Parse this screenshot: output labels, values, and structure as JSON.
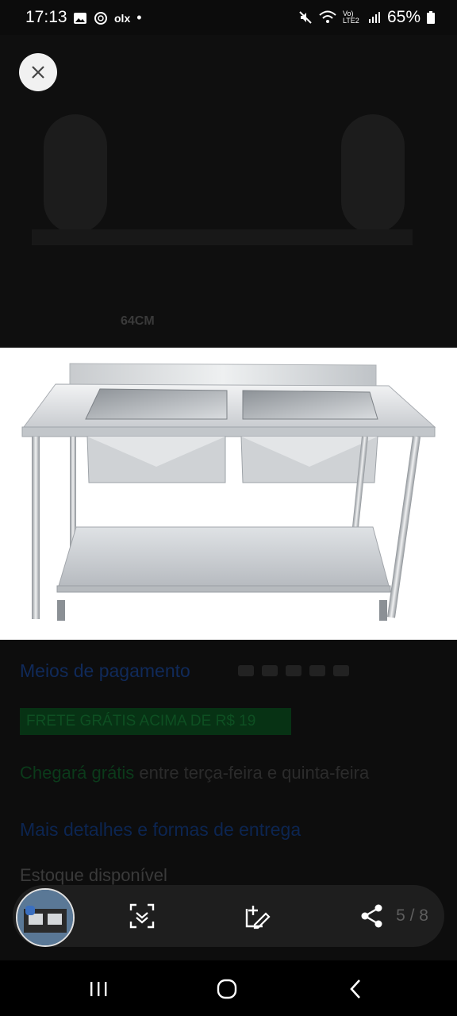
{
  "status_bar": {
    "time": "17:13",
    "left_icons": [
      "image-icon",
      "threads-icon",
      "olx-icon",
      "dot-icon"
    ],
    "olx_label": "olx",
    "network_label": "Vo) LTE2",
    "battery": "65%"
  },
  "background": {
    "dimension_label": "64CM",
    "payment_label": "Meios de pagamento",
    "shipping_badge": "FRETE GRÁTIS ACIMA DE R$ 19",
    "arrival_highlight": "Chegará grátis",
    "arrival_rest": " entre terça-feira e quinta-feira",
    "delivery_link": "Mais detalhes e formas de entrega",
    "stock_label": "Estoque disponível"
  },
  "viewer": {
    "close_icon": "close-icon",
    "counter": "5 / 8"
  },
  "toolbar": {
    "icons": [
      "scan-icon",
      "edit-icon",
      "share-icon"
    ]
  },
  "colors": {
    "background": "#0c0c0c",
    "toolbar": "#1e1e1e",
    "photo_bg": "#ffffff",
    "steel_light": "#e6e8ea",
    "steel_dark": "#9ea3a8"
  }
}
